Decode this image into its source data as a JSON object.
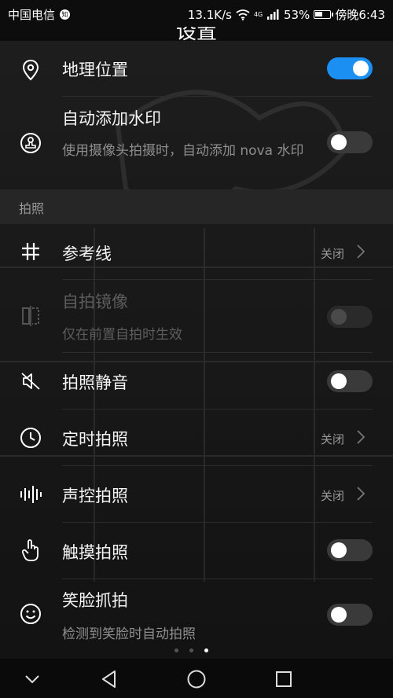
{
  "status_bar": {
    "carrier": "中国电信",
    "carrier_badge": "知",
    "speed": "13.1K/s",
    "network": "4G",
    "battery": "53%",
    "battery_level": 0.53,
    "time": "傍晚6:43"
  },
  "title": "设置",
  "settings": {
    "location": {
      "label": "地理位置",
      "enabled": true
    },
    "watermark": {
      "label": "自动添加水印",
      "desc": "使用摄像头拍摄时，自动添加 nova 水印",
      "enabled": false
    },
    "section_photo": "拍照",
    "gridline": {
      "label": "参考线",
      "value": "关闭"
    },
    "mirror": {
      "label": "自拍镜像",
      "desc": "仅在前置自拍时生效",
      "enabled": false,
      "disabled": true
    },
    "mute": {
      "label": "拍照静音",
      "enabled": false
    },
    "timer": {
      "label": "定时拍照",
      "value": "关闭"
    },
    "voice": {
      "label": "声控拍照",
      "value": "关闭"
    },
    "touch": {
      "label": "触摸拍照",
      "enabled": false
    },
    "smile": {
      "label": "笑脸抓拍",
      "desc": "检测到笑脸时自动拍照",
      "enabled": false
    }
  },
  "page_indicator": {
    "count": 3,
    "active": 3
  },
  "colors": {
    "accent": "#1c8ff2",
    "background": "#171717",
    "section_bg": "#262626"
  }
}
